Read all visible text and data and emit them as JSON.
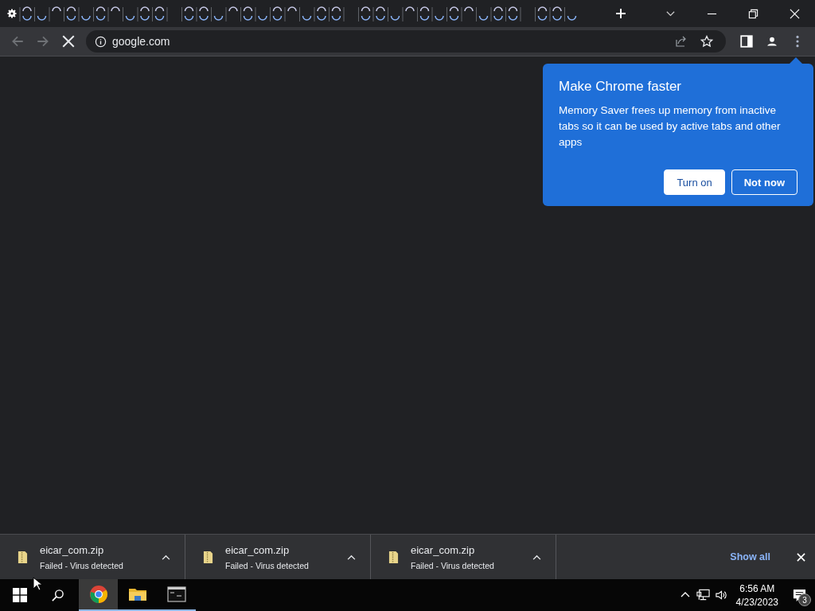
{
  "toolbar": {
    "url": "google.com",
    "loading": true
  },
  "bubble": {
    "title": "Make Chrome faster",
    "body": "Memory Saver frees up memory from inactive tabs so it can be used by active tabs and other apps",
    "buttons": [
      {
        "label": "Turn on",
        "kind": "primary"
      },
      {
        "label": "Not now",
        "kind": "secondary"
      }
    ]
  },
  "downloads": {
    "items": [
      {
        "name": "eicar_com.zip",
        "status": "Failed - Virus detected"
      },
      {
        "name": "eicar_com.zip",
        "status": "Failed - Virus detected"
      },
      {
        "name": "eicar_com.zip",
        "status": "Failed - Virus detected"
      }
    ],
    "show_all": "Show all"
  },
  "taskbar": {
    "apps": [
      {
        "kind": "chrome",
        "running": true,
        "active": true
      },
      {
        "kind": "explorer",
        "running": true,
        "active": false
      },
      {
        "kind": "terminal",
        "running": true,
        "active": false
      }
    ],
    "time": "6:56 AM",
    "date": "4/23/2023",
    "notifications": "3"
  }
}
